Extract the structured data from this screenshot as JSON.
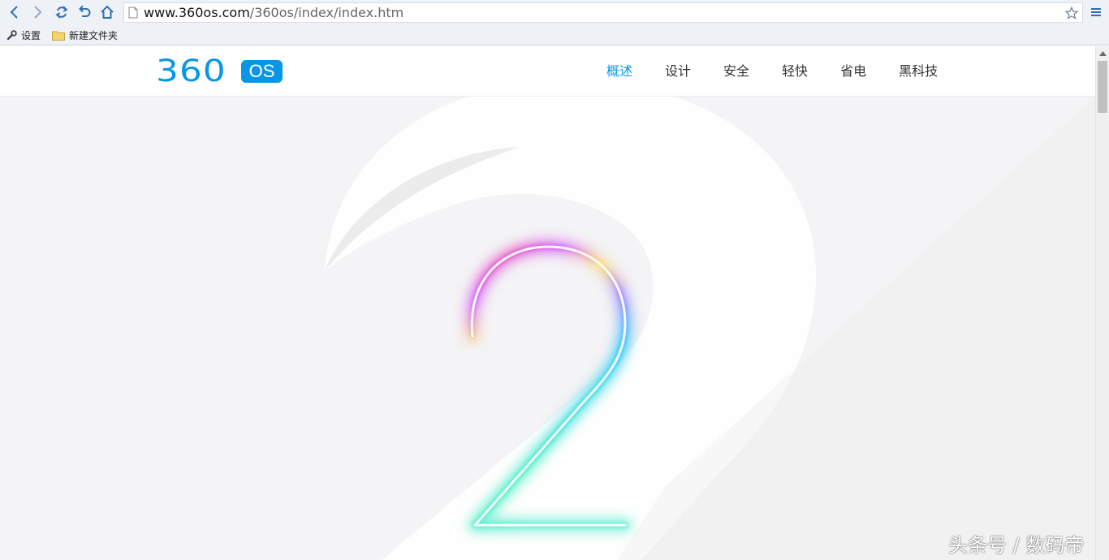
{
  "browser": {
    "url_host": "www.360os.com",
    "url_path": "/360os/index/index.htm",
    "bookmarks": [
      {
        "label": "设置",
        "icon": "wrench-icon"
      },
      {
        "label": "新建文件夹",
        "icon": "folder-icon"
      }
    ]
  },
  "site": {
    "logo_number": "360",
    "logo_os": "OS",
    "nav": [
      {
        "label": "概述",
        "active": true
      },
      {
        "label": "设计",
        "active": false
      },
      {
        "label": "安全",
        "active": false
      },
      {
        "label": "轻快",
        "active": false
      },
      {
        "label": "省电",
        "active": false
      },
      {
        "label": "黑科技",
        "active": false
      }
    ],
    "accent_color": "#0a96e6"
  },
  "hero": {
    "numeral": "2"
  },
  "watermark": "头条号 / 数码帝"
}
